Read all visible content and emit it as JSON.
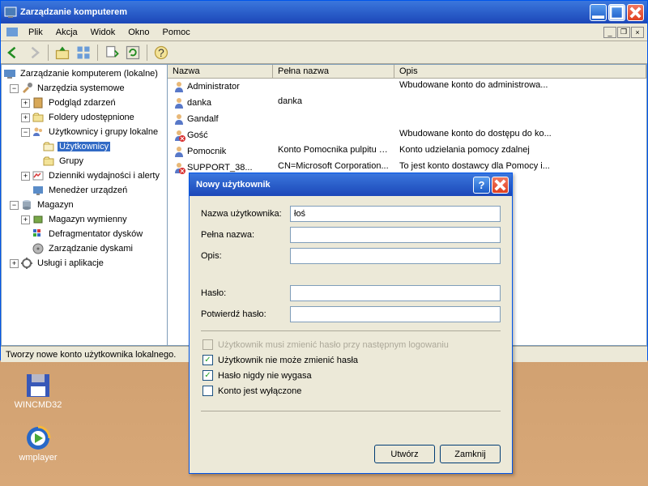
{
  "window": {
    "title": "Zarządzanie komputerem"
  },
  "menu": {
    "file": "Plik",
    "action": "Akcja",
    "view": "Widok",
    "window": "Okno",
    "help": "Pomoc"
  },
  "tree": {
    "root": "Zarządzanie komputerem (lokalne)",
    "system_tools": "Narzędzia systemowe",
    "event_viewer": "Podgląd zdarzeń",
    "shared_folders": "Foldery udostępnione",
    "local_users": "Użytkownicy i grupy lokalne",
    "users": "Użytkownicy",
    "groups": "Grupy",
    "perf_logs": "Dzienniki wydajności i alerty",
    "device_mgr": "Menedżer urządzeń",
    "storage": "Magazyn",
    "removable": "Magazyn wymienny",
    "defrag": "Defragmentator dysków",
    "disk_mgmt": "Zarządzanie dyskami",
    "services": "Usługi i aplikacje"
  },
  "list": {
    "col_name": "Nazwa",
    "col_fullname": "Pełna nazwa",
    "col_desc": "Opis",
    "rows": [
      {
        "name": "Administrator",
        "fullname": "",
        "desc": "Wbudowane konto do administrowa..."
      },
      {
        "name": "danka",
        "fullname": "danka",
        "desc": ""
      },
      {
        "name": "Gandalf",
        "fullname": "",
        "desc": ""
      },
      {
        "name": "Gość",
        "fullname": "",
        "desc": "Wbudowane konto do dostępu do ko..."
      },
      {
        "name": "Pomocnik",
        "fullname": "Konto Pomocnika pulpitu z...",
        "desc": "Konto udzielania pomocy zdalnej"
      },
      {
        "name": "SUPPORT_38...",
        "fullname": "CN=Microsoft Corporation...",
        "desc": "To jest konto dostawcy dla Pomocy i..."
      }
    ]
  },
  "statusbar": "Tworzy nowe konto użytkownika lokalnego.",
  "dialog": {
    "title": "Nowy użytkownik",
    "username_label": "Nazwa użytkownika:",
    "username_value": "łoś",
    "fullname_label": "Pełna nazwa:",
    "desc_label": "Opis:",
    "password_label": "Hasło:",
    "confirm_label": "Potwierdź hasło:",
    "cb_must_change": "Użytkownik musi zmienić hasło przy następnym logowaniu",
    "cb_cannot_change": "Użytkownik nie może zmienić hasła",
    "cb_never_expires": "Hasło nigdy nie wygasa",
    "cb_disabled": "Konto jest wyłączone",
    "btn_create": "Utwórz",
    "btn_close": "Zamknij"
  },
  "desktop": {
    "wincmd": "WINCMD32",
    "wmplayer": "wmplayer"
  }
}
